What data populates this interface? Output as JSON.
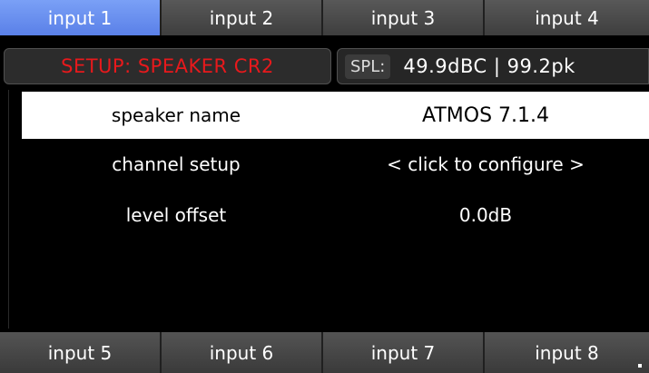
{
  "top_tabs": [
    {
      "label": "input 1",
      "active": true
    },
    {
      "label": "input 2",
      "active": false
    },
    {
      "label": "input 3",
      "active": false
    },
    {
      "label": "input 4",
      "active": false
    }
  ],
  "status": {
    "setup_title": "SETUP: SPEAKER CR2",
    "spl_label": "SPL:",
    "spl_value": "49.9dBC | 99.2pk"
  },
  "settings": [
    {
      "label": "speaker name",
      "value": "ATMOS 7.1.4",
      "selected": true
    },
    {
      "label": "channel setup",
      "value": "< click to configure >",
      "selected": false
    },
    {
      "label": "level offset",
      "value": "0.0dB",
      "selected": false
    }
  ],
  "bottom_tabs": [
    {
      "label": "input 5"
    },
    {
      "label": "input 6"
    },
    {
      "label": "input 7"
    },
    {
      "label": "input 8"
    }
  ],
  "colors": {
    "active_tab": "#6a90f0",
    "setup_title": "#e8191c"
  }
}
